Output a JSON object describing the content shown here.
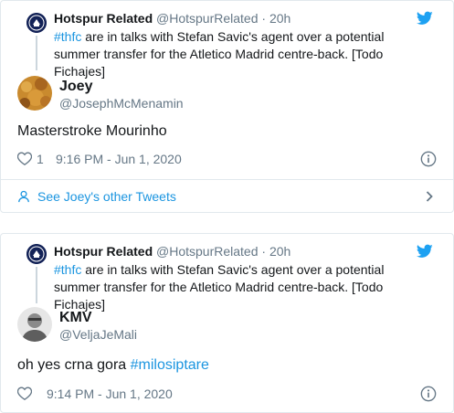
{
  "tweets": [
    {
      "context": {
        "name": "Hotspur Related",
        "handle": "@HotspurRelated",
        "time": "· 20h",
        "hashtag": "#thfc",
        "text": " are in talks with Stefan Savic's agent over a potential summer transfer for the Atletico Madrid centre-back. [Todo Fichajes]"
      },
      "author": {
        "name": "Joey",
        "handle": "@JosephMcMenamin"
      },
      "text": "Masterstroke Mourinho",
      "hashtag": "",
      "likes": "1",
      "timestamp": "9:16 PM - Jun 1, 2020",
      "more_label": "See Joey's other Tweets"
    },
    {
      "context": {
        "name": "Hotspur Related",
        "handle": "@HotspurRelated",
        "time": "· 20h",
        "hashtag": "#thfc",
        "text": " are in talks with Stefan Savic's agent over a potential summer transfer for the Atletico Madrid centre-back. [Todo Fichajes]"
      },
      "author": {
        "name": "KMV",
        "handle": "@VeljaJeMali"
      },
      "text": "oh yes crna gora ",
      "hashtag": "#milosiptare",
      "likes": "",
      "timestamp": "9:14 PM - Jun 1, 2020"
    }
  ],
  "icons": {
    "twitter": "twitter-bird-icon",
    "like": "heart-icon",
    "info": "info-icon",
    "person": "person-icon",
    "chevron": "chevron-right-icon"
  },
  "colors": {
    "twitter_blue": "#1da1f2",
    "link_blue": "#1b95e0",
    "secondary_text": "#657786",
    "spurs_navy": "#132257"
  }
}
